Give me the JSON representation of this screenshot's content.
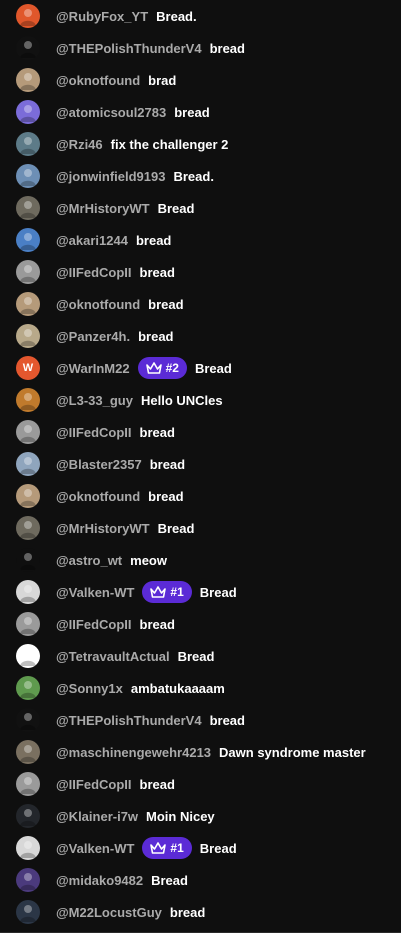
{
  "colors": {
    "background": "#0f0f0f",
    "author": "#aaaaaa",
    "message": "#ffffff",
    "badge": "#5b2bd6"
  },
  "messages": [
    {
      "author": "@RubyFox_YT",
      "text": "Bread.",
      "badge": "",
      "avatar": {
        "color": "#e0572b",
        "icon": "fox-avatar-icon"
      }
    },
    {
      "author": "@THEPolishThunderV4",
      "text": "bread",
      "badge": "",
      "avatar": {
        "color": "#111111",
        "icon": "thunder-avatar-icon"
      }
    },
    {
      "author": "@oknotfound",
      "text": "brad",
      "badge": "",
      "avatar": {
        "color": "#b59a7a",
        "icon": "dog-avatar-icon"
      }
    },
    {
      "author": "@atomicsoul2783",
      "text": "bread",
      "badge": "",
      "avatar": {
        "color": "#7b6cd9",
        "icon": "skull-avatar-icon"
      }
    },
    {
      "author": "@Rzi46",
      "text": "fix the challenger 2",
      "badge": "",
      "avatar": {
        "color": "#5d7b88",
        "icon": "tank-avatar-icon"
      }
    },
    {
      "author": "@jonwinfield9193",
      "text": "Bread.",
      "badge": "",
      "avatar": {
        "color": "#6d8fb5",
        "icon": "jet-avatar-icon"
      }
    },
    {
      "author": "@MrHistoryWT",
      "text": "Bread",
      "badge": "",
      "avatar": {
        "color": "#6e6a5e",
        "icon": "soldier-avatar-icon"
      }
    },
    {
      "author": "@akari1244",
      "text": "bread",
      "badge": "",
      "avatar": {
        "color": "#4a7fc5",
        "icon": "anime-avatar-icon"
      }
    },
    {
      "author": "@IIFedCopII",
      "text": "bread",
      "badge": "",
      "avatar": {
        "color": "#9a9a9a",
        "icon": "car-avatar-icon"
      }
    },
    {
      "author": "@oknotfound",
      "text": "bread",
      "badge": "",
      "avatar": {
        "color": "#b59a7a",
        "icon": "dog-avatar-icon"
      }
    },
    {
      "author": "@Panzer4h.",
      "text": "bread",
      "badge": "",
      "avatar": {
        "color": "#b8a98a",
        "icon": "tank-avatar-icon"
      }
    },
    {
      "author": "@WarInM22",
      "text": "Bread",
      "badge": "#2",
      "avatar": {
        "color": "#e4572e",
        "icon": "letter-w-avatar",
        "letter": "W"
      }
    },
    {
      "author": "@L3-33_guy",
      "text": "Hello UNCles",
      "badge": "",
      "avatar": {
        "color": "#c07a2c",
        "icon": "tankette-avatar-icon"
      }
    },
    {
      "author": "@IIFedCopII",
      "text": "bread",
      "badge": "",
      "avatar": {
        "color": "#9a9a9a",
        "icon": "car-avatar-icon"
      }
    },
    {
      "author": "@Blaster2357",
      "text": "bread",
      "badge": "",
      "avatar": {
        "color": "#8fa5bd",
        "icon": "plane-avatar-icon"
      }
    },
    {
      "author": "@oknotfound",
      "text": "bread",
      "badge": "",
      "avatar": {
        "color": "#b59a7a",
        "icon": "dog-avatar-icon"
      }
    },
    {
      "author": "@MrHistoryWT",
      "text": "Bread",
      "badge": "",
      "avatar": {
        "color": "#6e6a5e",
        "icon": "soldier-avatar-icon"
      }
    },
    {
      "author": "@astro_wt",
      "text": "meow",
      "badge": "",
      "avatar": {
        "color": "#0f0f0f",
        "icon": "astro-logo-avatar-icon"
      }
    },
    {
      "author": "@Valken-WT",
      "text": "Bread",
      "badge": "#1",
      "avatar": {
        "color": "#d8d8d8",
        "icon": "emblem-avatar-icon"
      }
    },
    {
      "author": "@IIFedCopII",
      "text": "bread",
      "badge": "",
      "avatar": {
        "color": "#9a9a9a",
        "icon": "car-avatar-icon"
      }
    },
    {
      "author": "@TetravaultActual",
      "text": "Bread",
      "badge": "",
      "avatar": {
        "color": "#ffffff",
        "icon": "tetravault-logo-avatar-icon"
      }
    },
    {
      "author": "@Sonny1x",
      "text": "ambatukaaaam",
      "badge": "",
      "avatar": {
        "color": "#5f9a4e",
        "icon": "tank-avatar-icon"
      }
    },
    {
      "author": "@THEPolishThunderV4",
      "text": "bread",
      "badge": "",
      "avatar": {
        "color": "#111111",
        "icon": "thunder-avatar-icon"
      }
    },
    {
      "author": "@maschinengewehr4213",
      "text": "Dawn syndrome master",
      "badge": "",
      "avatar": {
        "color": "#7a7060",
        "icon": "machine-gun-avatar-icon"
      }
    },
    {
      "author": "@IIFedCopII",
      "text": "bread",
      "badge": "",
      "avatar": {
        "color": "#9a9a9a",
        "icon": "car-avatar-icon"
      }
    },
    {
      "author": "@Klainer-i7w",
      "text": "Moin Nicey",
      "badge": "",
      "avatar": {
        "color": "#23262b",
        "icon": "dark-avatar-icon"
      }
    },
    {
      "author": "@Valken-WT",
      "text": "Bread",
      "badge": "#1",
      "avatar": {
        "color": "#d8d8d8",
        "icon": "emblem-avatar-icon"
      }
    },
    {
      "author": "@midako9482",
      "text": "Bread",
      "badge": "",
      "avatar": {
        "color": "#4b3a7d",
        "icon": "anime-avatar-icon"
      }
    },
    {
      "author": "@M22LocustGuy",
      "text": "bread",
      "badge": "",
      "avatar": {
        "color": "#2b3646",
        "icon": "locust-avatar-icon"
      }
    }
  ]
}
